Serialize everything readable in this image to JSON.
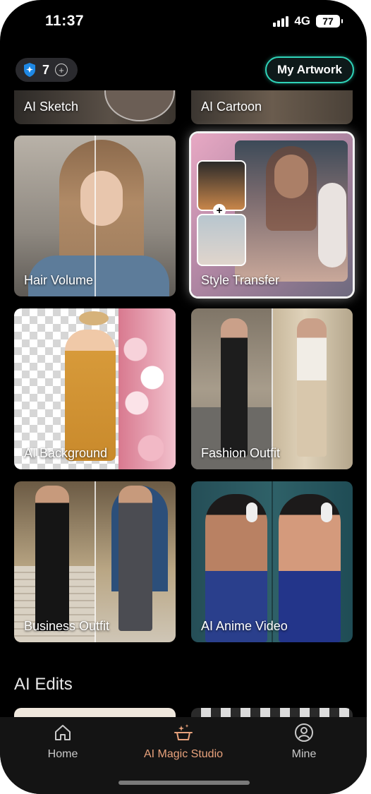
{
  "status": {
    "time": "11:37",
    "network": "4G",
    "battery": "77"
  },
  "header": {
    "credits": "7",
    "artwork_button": "My Artwork"
  },
  "cards": {
    "sketch": "AI Sketch",
    "cartoon": "AI Cartoon",
    "hair": "Hair Volume",
    "style": "Style Transfer",
    "background": "AI Background",
    "fashion": "Fashion Outfit",
    "business": "Business Outfit",
    "anime": "AI Anime Video"
  },
  "sections": {
    "edits": "AI Edits"
  },
  "nav": {
    "home": "Home",
    "studio": "AI Magic Studio",
    "mine": "Mine"
  },
  "colors": {
    "accent": "#2fd3b8",
    "active_tab": "#e8a27c"
  }
}
